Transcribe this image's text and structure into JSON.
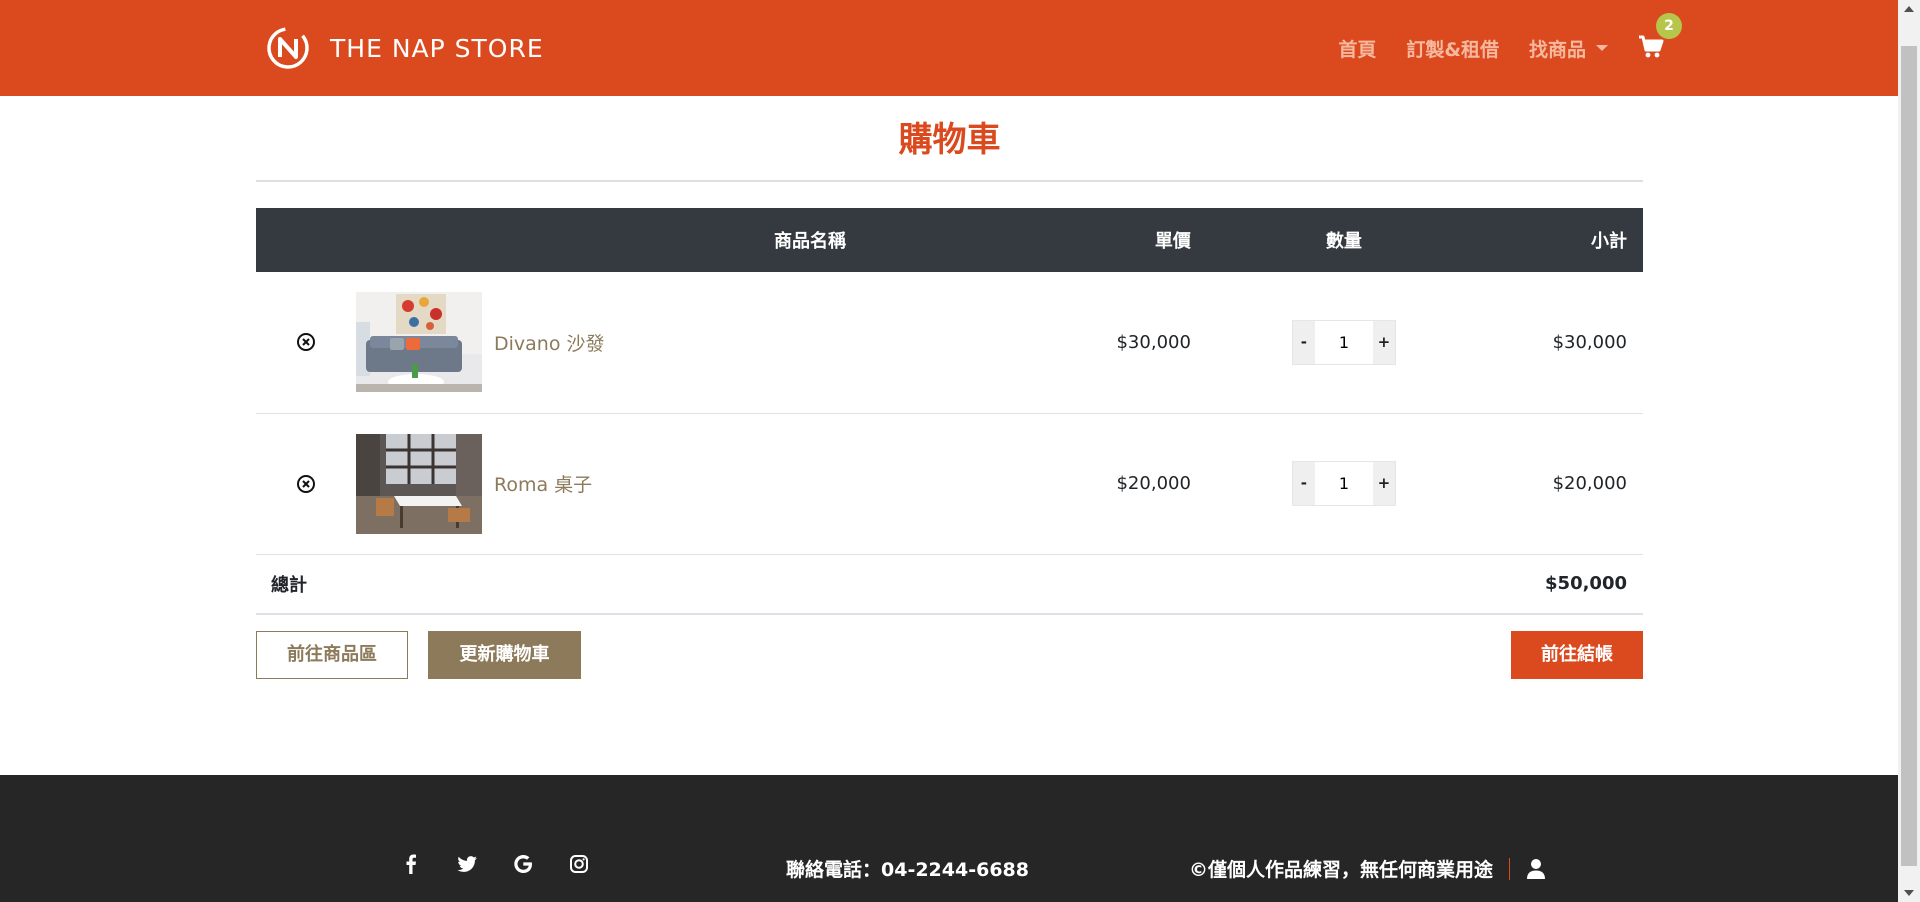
{
  "colors": {
    "brand": "#db4a1e",
    "accent": "#8c7a5b",
    "header_row": "#343a40",
    "footer": "#262626",
    "badge": "#b5c64a"
  },
  "navbar": {
    "brand_text": "THE NAP STORE",
    "links": [
      {
        "label": "首頁"
      },
      {
        "label": "訂製&租借"
      },
      {
        "label": "找商品"
      }
    ],
    "cart_count": "2"
  },
  "cart": {
    "title": "購物車",
    "columns": {
      "name": "商品名稱",
      "price": "單價",
      "quantity": "數量",
      "subtotal": "小計"
    },
    "items": [
      {
        "name": "Divano 沙發",
        "price": "$30,000",
        "quantity": "1",
        "subtotal": "$30,000",
        "image": "sofa-photo"
      },
      {
        "name": "Roma 桌子",
        "price": "$20,000",
        "quantity": "1",
        "subtotal": "$20,000",
        "image": "table-photo"
      }
    ],
    "qty_minus": "-",
    "qty_plus": "+",
    "total_label": "總計",
    "total_value": "$50,000"
  },
  "actions": {
    "continue_label": "前往商品區",
    "update_label": "更新購物車",
    "checkout_label": "前往結帳"
  },
  "footer": {
    "social_icons": [
      "facebook-icon",
      "twitter-icon",
      "google-icon",
      "instagram-icon"
    ],
    "phone": "聯絡電話：04-2244-6688",
    "copyright": "©僅個人作品練習，無任何商業用途"
  }
}
